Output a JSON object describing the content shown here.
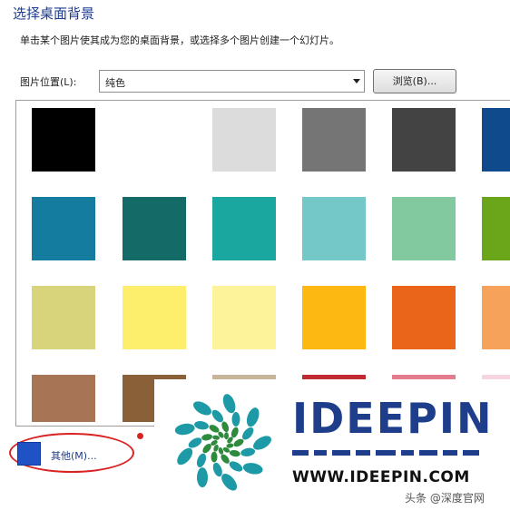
{
  "page_title": "选择桌面背景",
  "instruction": "单击某个图片使其成为您的桌面背景，或选择多个图片创建一个幻灯片。",
  "picture_location": {
    "label": "图片位置(L):",
    "value": "纯色",
    "browse_button": "浏览(B)..."
  },
  "colors": [
    [
      "#000000",
      "#ffffff",
      "#dcdcdc",
      "#757575",
      "#434343",
      "#0f4b8c"
    ],
    [
      "#147c9f",
      "#146a66",
      "#1aa7a0",
      "#74c9c8",
      "#82c99f",
      "#6ba61a"
    ],
    [
      "#d8d47c",
      "#fdef6c",
      "#fdf39a",
      "#fdb811",
      "#ea6419",
      "#f6a25a"
    ],
    [
      "#a77455",
      "#8a6039",
      "#c7b59a",
      "#c02b32",
      "#e37d8d",
      "#f6d5de"
    ]
  ],
  "other_color": {
    "label": "其他(M)...",
    "swatch_color": "#1f53c5"
  },
  "watermark": {
    "name": "IDEEPIN",
    "url": "WWW.IDEEPIN.COM",
    "credit": "头条 @深度官网"
  }
}
